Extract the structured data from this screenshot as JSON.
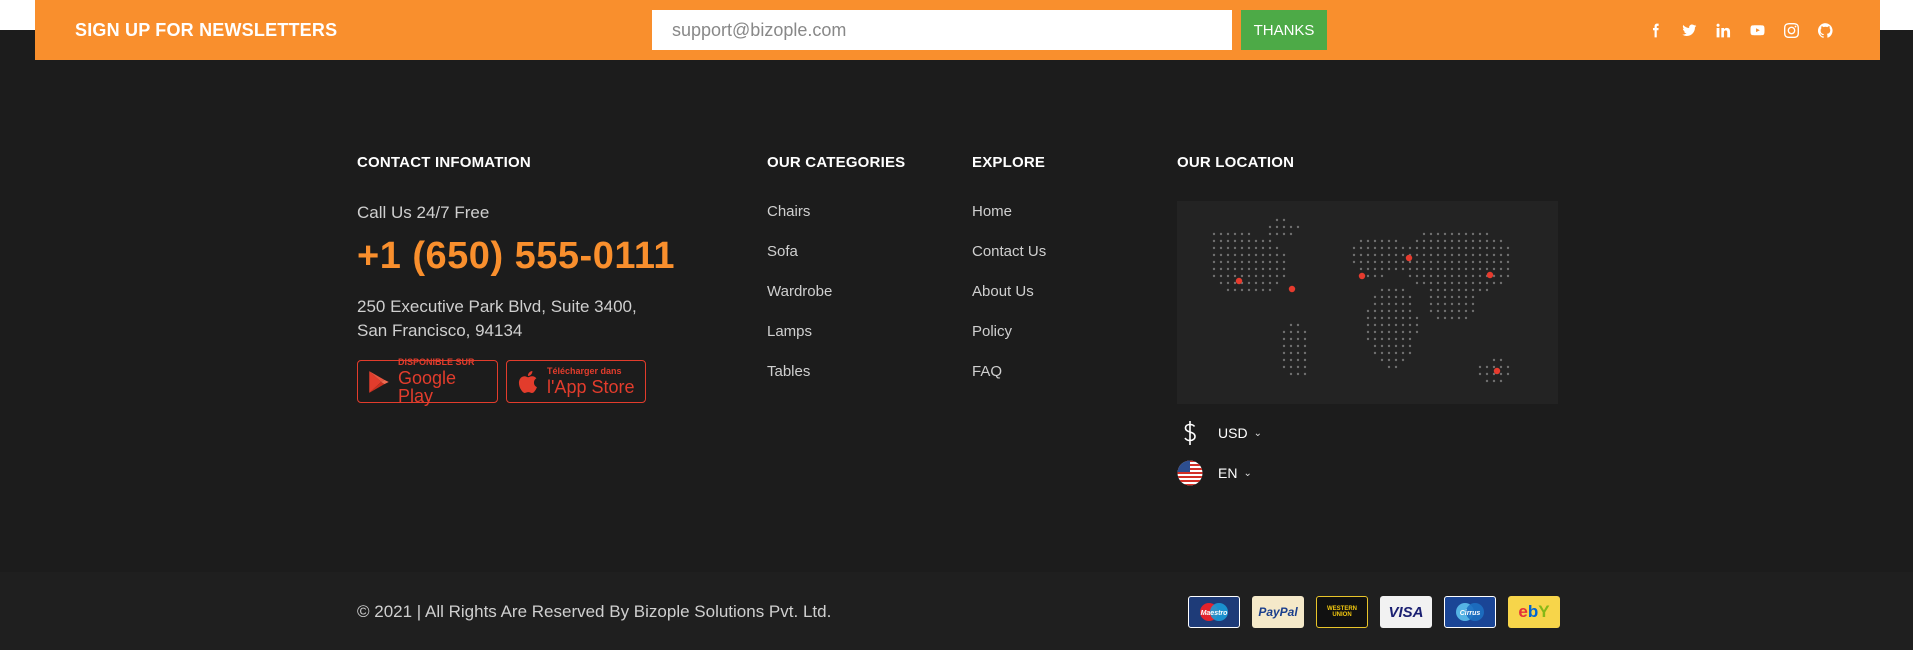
{
  "newsletter": {
    "title": "SIGN UP FOR NEWSLETTERS",
    "email_value": "support@bizople.com",
    "button_label": "THANKS",
    "socials": [
      "facebook-icon",
      "twitter-icon",
      "linkedin-icon",
      "youtube-icon",
      "instagram-icon",
      "github-icon"
    ]
  },
  "contact": {
    "heading": "CONTACT INFOMATION",
    "call_label": "Call Us 24/7 Free",
    "phone": "+1 (650) 555-0111",
    "address_line1": "250 Executive Park Blvd, Suite 3400,",
    "address_line2": "San Francisco, 94134",
    "google_play_small": "DISPONIBLE SUR",
    "google_play_big": "Google Play",
    "app_store_small": "Télécharger dans",
    "app_store_big": "l'App Store"
  },
  "categories": {
    "heading": "OUR CATEGORIES",
    "items": [
      "Chairs",
      "Sofa",
      "Wardrobe",
      "Lamps",
      "Tables"
    ]
  },
  "explore": {
    "heading": "EXPLORE",
    "items": [
      "Home",
      "Contact Us",
      "About Us",
      "Policy",
      "FAQ"
    ]
  },
  "location": {
    "heading": "OUR LOCATION",
    "currency": "USD",
    "language": "EN"
  },
  "bottom": {
    "copyright": "© 2021 | All Rights Are Reserved By Bizople Solutions Pvt. Ltd.",
    "payments": [
      {
        "name": "maestro-icon",
        "label": "Maestro"
      },
      {
        "name": "paypal-icon",
        "label": "PayPal"
      },
      {
        "name": "western-union-icon",
        "label": "WESTERN UNION"
      },
      {
        "name": "visa-icon",
        "label": "VISA"
      },
      {
        "name": "cirrus-icon",
        "label": "Cirrus"
      },
      {
        "name": "ebay-icon",
        "label": "ebY"
      }
    ]
  },
  "colors": {
    "accent": "#f98f2d",
    "button_green": "#4daa47",
    "footer_bg": "#1c1c1c",
    "store_red": "#e23c2c"
  }
}
